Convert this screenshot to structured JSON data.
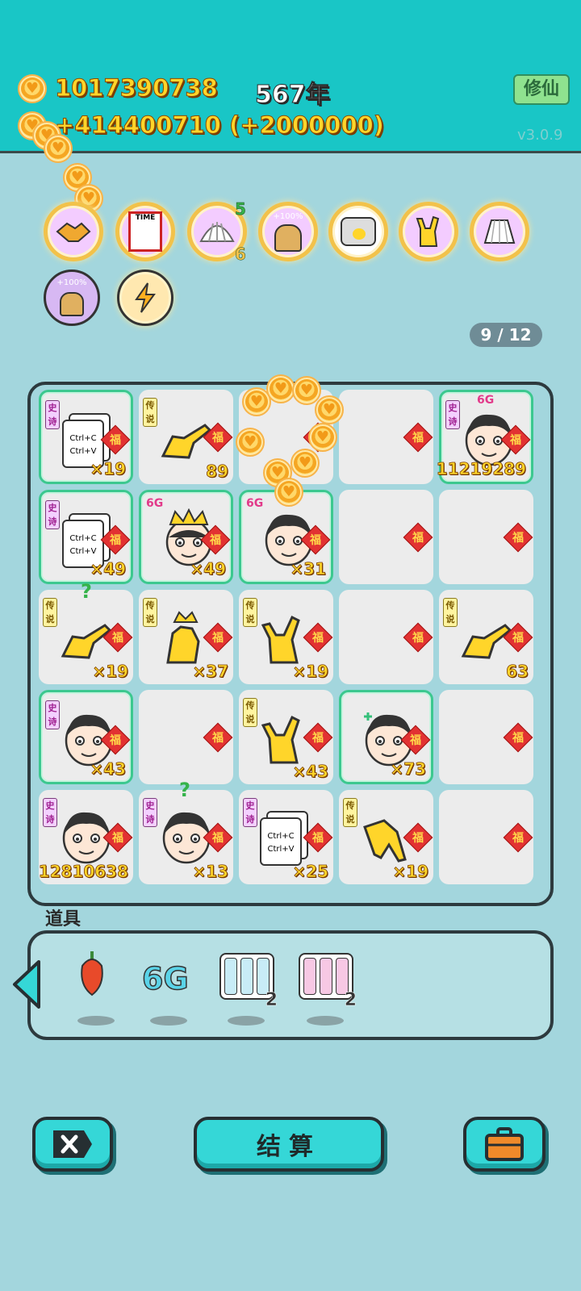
{
  "header": {
    "coins_total": "1017390738",
    "coins_rate": "+414400710 (+2000000)",
    "year": "567年",
    "xiuxian_label": "修仙",
    "version": "v3.0.9"
  },
  "skills": [
    {
      "name": "handshake-icon",
      "badge_top": "",
      "badge_bottom": ""
    },
    {
      "name": "time-magazine-icon",
      "badge_top": "",
      "badge_bottom": ""
    },
    {
      "name": "shell-icon",
      "badge_top": "5",
      "badge_bottom": "6"
    },
    {
      "name": "cup-plus-100-icon",
      "label": "+100%"
    },
    {
      "name": "pot-duck-icon"
    },
    {
      "name": "rock-hand-icon"
    },
    {
      "name": "skirt-icon"
    },
    {
      "name": "cup-plus-100-small-icon",
      "label": "+100%"
    },
    {
      "name": "lightning-icon"
    }
  ],
  "pager": "9 / 12",
  "tag_labels": {
    "epic": "史诗",
    "legend": "传说"
  },
  "fu_label": "福",
  "grid": [
    [
      {
        "tag": "epic",
        "icon": "copy-paste-card",
        "count": "×19",
        "border": true
      },
      {
        "tag": "legend",
        "icon": "pointing-hand",
        "count": "89"
      },
      {
        "tag": "",
        "icon": "",
        "count": ""
      },
      {
        "tag": "",
        "icon": "",
        "count": ""
      },
      {
        "tag": "epic",
        "icon": "face",
        "count": "11219289",
        "badge": "6G",
        "border": true
      }
    ],
    [
      {
        "tag": "epic",
        "icon": "copy-paste-card",
        "count": "×49",
        "border": true
      },
      {
        "tag": "",
        "icon": "face-crown",
        "count": "×49",
        "badge": "6G",
        "border": true
      },
      {
        "tag": "",
        "icon": "face",
        "count": "×31",
        "badge": "6G",
        "border": true
      },
      {
        "tag": "",
        "icon": "",
        "count": ""
      },
      {
        "tag": "",
        "icon": "",
        "count": ""
      }
    ],
    [
      {
        "tag": "legend",
        "icon": "pointing-hand",
        "count": "×19",
        "mark": "?"
      },
      {
        "tag": "legend",
        "icon": "pointing-hand-crown",
        "count": "×37"
      },
      {
        "tag": "legend",
        "icon": "rock-hand",
        "count": "×19"
      },
      {
        "tag": "",
        "icon": "",
        "count": ""
      },
      {
        "tag": "legend",
        "icon": "pointing-hand",
        "count": "63"
      }
    ],
    [
      {
        "tag": "epic",
        "icon": "face",
        "count": "×43",
        "border": true
      },
      {
        "tag": "",
        "icon": "",
        "count": ""
      },
      {
        "tag": "legend",
        "icon": "rock-hand",
        "count": "×43"
      },
      {
        "tag": "",
        "icon": "face-plus",
        "count": "×73",
        "border": true
      },
      {
        "tag": "",
        "icon": "",
        "count": ""
      }
    ],
    [
      {
        "tag": "epic",
        "icon": "face",
        "count": "12810638"
      },
      {
        "tag": "epic",
        "icon": "face",
        "count": "×13",
        "mark": "?"
      },
      {
        "tag": "epic",
        "icon": "copy-paste-card",
        "count": "×25"
      },
      {
        "tag": "legend",
        "icon": "pointing-hand-down",
        "count": "×19"
      },
      {
        "tag": "",
        "icon": "",
        "count": ""
      }
    ]
  ],
  "card_text": {
    "line1": "Ctrl+C",
    "line2": "Ctrl+V"
  },
  "items": {
    "label": "道具",
    "list": [
      {
        "name": "chili-icon",
        "qty": ""
      },
      {
        "name": "6g-icon",
        "text": "6G",
        "qty": ""
      },
      {
        "name": "green-scrolls-icon",
        "qty": "2"
      },
      {
        "name": "red-scrolls-icon",
        "qty": "2"
      }
    ]
  },
  "buttons": {
    "settle": "结算"
  },
  "colors": {
    "topbar": "#19c6c6",
    "background": "#a3d6dd",
    "button": "#35d7d7",
    "gold": "#ffd52a",
    "fu": "#e23232"
  }
}
